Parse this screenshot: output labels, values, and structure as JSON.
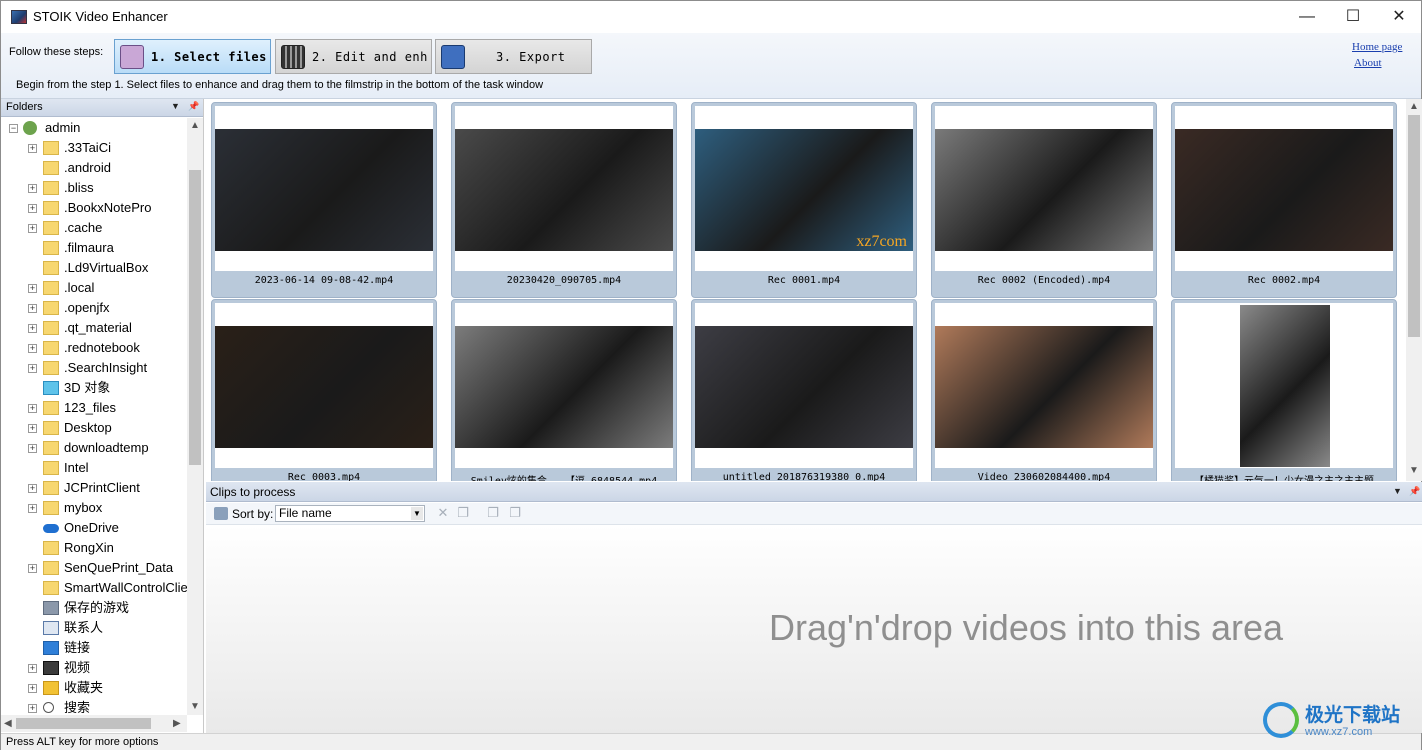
{
  "window": {
    "title": "STOIK Video Enhancer",
    "min": "—",
    "max": "☐",
    "close": "✕"
  },
  "toolbar": {
    "steps_label": "Follow these steps:",
    "steps": [
      {
        "label": "1. Select files",
        "active": true
      },
      {
        "label": "2. Edit and enh...",
        "active": false
      },
      {
        "label": "3. Export",
        "active": false
      }
    ],
    "home_link": "Home page",
    "about_link": "About",
    "hint": "Begin from the step 1. Select files to enhance and drag them to the filmstrip in the bottom of the task window"
  },
  "folders": {
    "title": "Folders",
    "root": "admin",
    "items": [
      {
        "name": ".33TaiCi",
        "icon": "folder-icon",
        "expandable": true
      },
      {
        "name": ".android",
        "icon": "folder-icon",
        "expandable": false
      },
      {
        "name": ".bliss",
        "icon": "folder-icon",
        "expandable": true
      },
      {
        "name": ".BookxNotePro",
        "icon": "folder-icon",
        "expandable": true
      },
      {
        "name": ".cache",
        "icon": "folder-icon",
        "expandable": true
      },
      {
        "name": ".filmaura",
        "icon": "folder-icon",
        "expandable": false
      },
      {
        "name": ".Ld9VirtualBox",
        "icon": "folder-icon",
        "expandable": false
      },
      {
        "name": ".local",
        "icon": "folder-icon",
        "expandable": true
      },
      {
        "name": ".openjfx",
        "icon": "folder-icon",
        "expandable": true
      },
      {
        "name": ".qt_material",
        "icon": "folder-icon",
        "expandable": true
      },
      {
        "name": ".rednotebook",
        "icon": "folder-icon",
        "expandable": true
      },
      {
        "name": ".SearchInsight",
        "icon": "folder-icon",
        "expandable": true
      },
      {
        "name": "3D 对象",
        "icon": "3d-objects-icon",
        "expandable": false
      },
      {
        "name": "123_files",
        "icon": "folder-icon",
        "expandable": true
      },
      {
        "name": "Desktop",
        "icon": "folder-icon",
        "expandable": true
      },
      {
        "name": "downloadtemp",
        "icon": "folder-icon",
        "expandable": true
      },
      {
        "name": "Intel",
        "icon": "folder-icon",
        "expandable": false
      },
      {
        "name": "JCPrintClient",
        "icon": "folder-icon",
        "expandable": true
      },
      {
        "name": "mybox",
        "icon": "folder-icon",
        "expandable": true
      },
      {
        "name": "OneDrive",
        "icon": "onedrive-icon",
        "expandable": false
      },
      {
        "name": "RongXin",
        "icon": "folder-icon",
        "expandable": false
      },
      {
        "name": "SenQuePrint_Data",
        "icon": "folder-icon",
        "expandable": true
      },
      {
        "name": "SmartWallControlClie",
        "icon": "folder-icon",
        "expandable": false
      },
      {
        "name": "保存的游戏",
        "icon": "saved-games-icon",
        "expandable": false
      },
      {
        "name": "联系人",
        "icon": "contacts-icon",
        "expandable": false
      },
      {
        "name": "链接",
        "icon": "links-icon",
        "expandable": false
      },
      {
        "name": "视频",
        "icon": "videos-icon",
        "expandable": true
      },
      {
        "name": "收藏夹",
        "icon": "favorites-icon",
        "expandable": true
      },
      {
        "name": "搜索",
        "icon": "search-icon",
        "expandable": true
      }
    ]
  },
  "gallery": {
    "tiles": [
      {
        "caption": "2023-06-14 09-08-42.mp4",
        "bg": "#2b2f36"
      },
      {
        "caption": "20230420_090705.mp4",
        "bg": "#4a4a4a"
      },
      {
        "caption": "Rec 0001.mp4",
        "bg": "#2e5e7e"
      },
      {
        "caption": "Rec 0002 (Encoded).mp4",
        "bg": "#7a7a7a"
      },
      {
        "caption": "Rec 0002.mp4",
        "bg": "#3a2a24"
      },
      {
        "caption": "Rec 0003.mp4",
        "bg": "#2a2018"
      },
      {
        "caption": "Smiley炫的集合...【逗 6848544.mp4",
        "bg": "#7c7c7c"
      },
      {
        "caption": "untitled 201876319380 0.mp4",
        "bg": "#3d3d44"
      },
      {
        "caption": "Video 230602084400.mp4",
        "bg": "#b07a5a"
      },
      {
        "caption": "【橘猫酱】元气一！少女漫之主之主主题",
        "bg": "#8a8a8a"
      }
    ],
    "overlay_text": {
      "xz7": "xz7com"
    }
  },
  "clips": {
    "title": "Clips to process",
    "sort_label": "Sort by:",
    "sort_value": "File name",
    "drop_text": "Drag'n'drop videos into this area"
  },
  "status": {
    "text": "Press ALT key for more options"
  },
  "watermark": {
    "text": "极光下载站",
    "url": "www.xz7.com"
  }
}
